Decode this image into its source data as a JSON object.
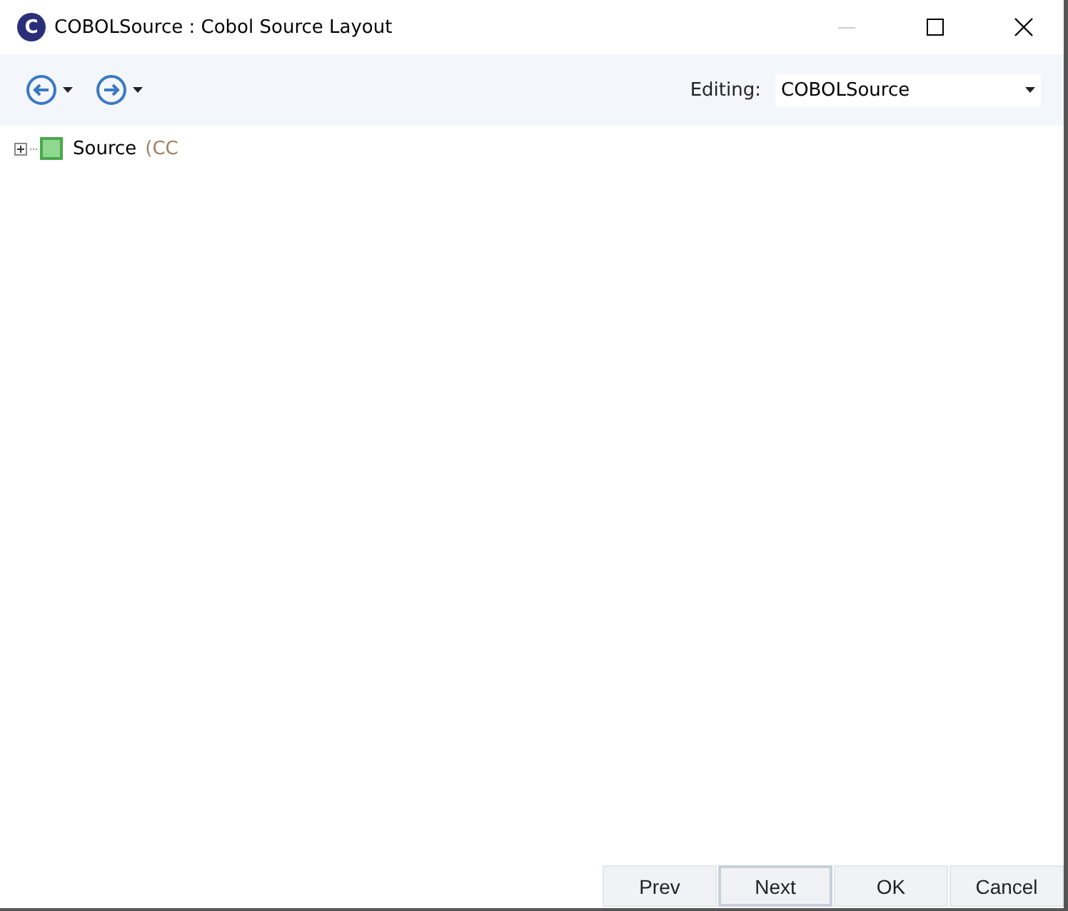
{
  "window": {
    "title": "COBOLSource : Cobol Source Layout",
    "app_icon": "C",
    "minimize_disabled": true
  },
  "toolbar": {
    "editing_label": "Editing:",
    "editing_value": "COBOLSource"
  },
  "tree": [
    {
      "label": "Source",
      "detail": "(CC",
      "expanded": false
    }
  ],
  "buttons": [
    {
      "label": "Prev",
      "selected": false
    },
    {
      "label": "Next",
      "selected": true
    },
    {
      "label": "OK",
      "selected": false
    },
    {
      "label": "Cancel",
      "selected": false
    }
  ]
}
